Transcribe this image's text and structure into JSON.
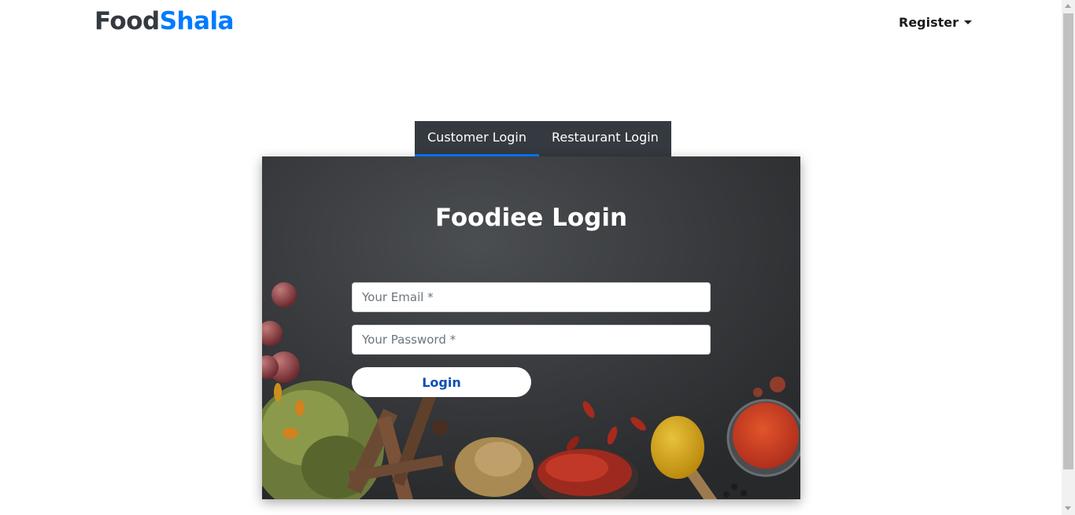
{
  "brand": {
    "part1": "Food",
    "part2": "Shala",
    "color_dark": "#343a40",
    "color_accent": "#007bff"
  },
  "navbar": {
    "register_label": "Register"
  },
  "tabs": [
    {
      "label": "Customer Login",
      "active": true
    },
    {
      "label": "Restaurant Login",
      "active": false
    }
  ],
  "login": {
    "title": "Foodiee Login",
    "email_placeholder": "Your Email *",
    "password_placeholder": "Your Password *",
    "button_label": "Login"
  }
}
